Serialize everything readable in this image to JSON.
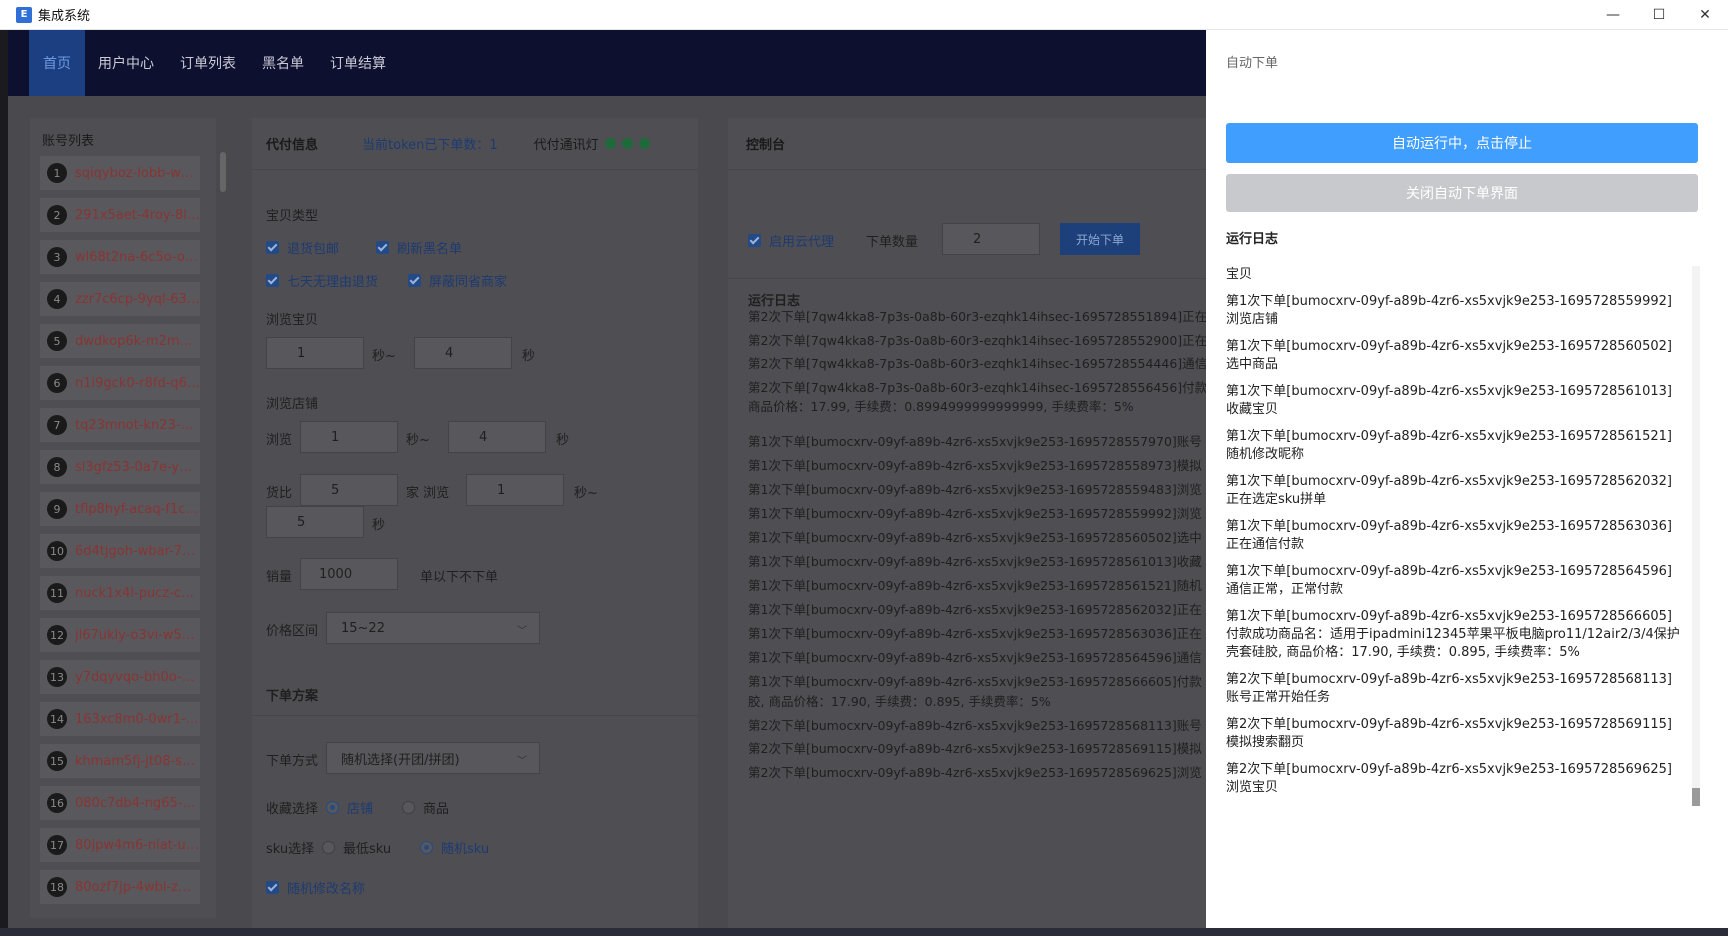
{
  "window": {
    "title": "集成系统",
    "icon": "app-icon",
    "minimize": "—",
    "maximize": "☐",
    "close": "✕"
  },
  "nav": {
    "items": [
      "首页",
      "用户中心",
      "订单列表",
      "黑名单",
      "订单结算"
    ],
    "active": "首页"
  },
  "accounts": {
    "title": "账号列表",
    "items": [
      {
        "n": "1",
        "name": "sqiqyboz-lobb-wm4..."
      },
      {
        "n": "2",
        "name": "291x5aet-4roy-8luk..."
      },
      {
        "n": "3",
        "name": "wl68t2na-6c5o-ofkg..."
      },
      {
        "n": "4",
        "name": "zzr7c6cp-9yql-63wv..."
      },
      {
        "n": "5",
        "name": "dwdkop6k-m2m9-m..."
      },
      {
        "n": "6",
        "name": "n1i9gck0-r8fd-q6ef-..."
      },
      {
        "n": "7",
        "name": "tq23mnot-kn23-85f..."
      },
      {
        "n": "8",
        "name": "sl3gfz53-0a7e-y27r..."
      },
      {
        "n": "9",
        "name": "tflp8hyf-acaq-f1ci-h..."
      },
      {
        "n": "10",
        "name": "6d4tjgoh-wbar-7a..."
      },
      {
        "n": "11",
        "name": "nuck1x4l-pucz-cpo..."
      },
      {
        "n": "12",
        "name": "jl67ukly-o3vi-w5z9..."
      },
      {
        "n": "13",
        "name": "y7dqyvqo-bh0o-zf..."
      },
      {
        "n": "14",
        "name": "163xc8m0-0wr1-q..."
      },
      {
        "n": "15",
        "name": "khmam5fj-jt08-sqa..."
      },
      {
        "n": "16",
        "name": "080c7db4-ng65-ty..."
      },
      {
        "n": "17",
        "name": "80jpw4m6-niat-up..."
      },
      {
        "n": "18",
        "name": "80ozf7jp-4wbl-zm..."
      }
    ]
  },
  "agent": {
    "title": "代付信息",
    "token_count": "当前token已下单数：1",
    "light_label": "代付通讯灯",
    "light_color": "#1e6a3a",
    "item_type_label": "宝贝类型",
    "checks": {
      "return_free": "退货包邮",
      "refresh_blacklist": "刷新黑名单",
      "seven_day": "七天无理由退货",
      "block_same": "屏蔽同省商家"
    },
    "browse_item_label": "浏览宝贝",
    "browse_item_min": "1",
    "browse_item_sep": "秒~",
    "browse_item_max": "4",
    "browse_item_unit": "秒",
    "browse_shop_label": "浏览店铺",
    "browse_label": "浏览",
    "browse_shop_min": "1",
    "browse_shop_sep": "秒~",
    "browse_shop_max": "4",
    "browse_shop_unit": "秒",
    "compare_label": "货比",
    "compare_val": "5",
    "compare_unit": "家 浏览",
    "compare_browse_min": "1",
    "compare_browse_sep": "秒~",
    "compare_browse_max": "5",
    "compare_browse_unit": "秒",
    "sales_label": "销量",
    "sales_val": "1000",
    "sales_unit": "单以下不下单",
    "price_label": "价格区间",
    "price_val": "15~22",
    "plan_label": "下单方案",
    "order_method_label": "下单方式",
    "order_method_val": "随机选择(开团/拼团)",
    "fav_label": "收藏选择",
    "fav_shop": "店铺",
    "fav_item": "商品",
    "sku_label": "sku选择",
    "sku_min": "最低sku",
    "sku_random": "随机sku",
    "rename": "随机修改名称"
  },
  "console": {
    "title": "控制台",
    "cloud_proxy": "启用云代理",
    "qty_label": "下单数量",
    "qty_val": "2",
    "start_label": "开始下单",
    "log_title": "运行日志",
    "lines": [
      "第2次下单[7qw4kka8-7p3s-0a8b-60r3-ezqhk14ihsec-1695728551894]正在",
      "第2次下单[7qw4kka8-7p3s-0a8b-60r3-ezqhk14ihsec-1695728552900]正在",
      "第2次下单[7qw4kka8-7p3s-0a8b-60r3-ezqhk14ihsec-1695728554446]通信",
      "第2次下单[7qw4kka8-7p3s-0a8b-60r3-ezqhk14ihsec-1695728556456]付款",
      "商品价格：17.99, 手续费：0.8994999999999999, 手续费率：5%",
      "第1次下单[bumocxrv-09yf-a89b-4zr6-xs5xvjk9e253-1695728557970]账号",
      "第1次下单[bumocxrv-09yf-a89b-4zr6-xs5xvjk9e253-1695728558973]模拟",
      "第1次下单[bumocxrv-09yf-a89b-4zr6-xs5xvjk9e253-1695728559483]浏览",
      "第1次下单[bumocxrv-09yf-a89b-4zr6-xs5xvjk9e253-1695728559992]浏览",
      "第1次下单[bumocxrv-09yf-a89b-4zr6-xs5xvjk9e253-1695728560502]选中",
      "第1次下单[bumocxrv-09yf-a89b-4zr6-xs5xvjk9e253-1695728561013]收藏",
      "第1次下单[bumocxrv-09yf-a89b-4zr6-xs5xvjk9e253-1695728561521]随机",
      "第1次下单[bumocxrv-09yf-a89b-4zr6-xs5xvjk9e253-1695728562032]正在",
      "第1次下单[bumocxrv-09yf-a89b-4zr6-xs5xvjk9e253-1695728563036]正在",
      "第1次下单[bumocxrv-09yf-a89b-4zr6-xs5xvjk9e253-1695728564596]通信",
      "第1次下单[bumocxrv-09yf-a89b-4zr6-xs5xvjk9e253-1695728566605]付款",
      "胶, 商品价格：17.90, 手续费：0.895, 手续费率：5%",
      "第2次下单[bumocxrv-09yf-a89b-4zr6-xs5xvjk9e253-1695728568113]账号",
      "第2次下单[bumocxrv-09yf-a89b-4zr6-xs5xvjk9e253-1695728569115]模拟",
      "第2次下单[bumocxrv-09yf-a89b-4zr6-xs5xvjk9e253-1695728569625]浏览"
    ]
  },
  "drawer": {
    "title": "自动下单",
    "stop_btn": "自动运行中，点击停止",
    "close_btn": "关闭自动下单界面",
    "log_title": "运行日志",
    "accent": "#409eff",
    "logs": [
      "宝贝",
      "第1次下单[bumocxrv-09yf-a89b-4zr6-xs5xvjk9e253-1695728559992]浏览店铺",
      "第1次下单[bumocxrv-09yf-a89b-4zr6-xs5xvjk9e253-1695728560502]选中商品",
      "第1次下单[bumocxrv-09yf-a89b-4zr6-xs5xvjk9e253-1695728561013]收藏宝贝",
      "第1次下单[bumocxrv-09yf-a89b-4zr6-xs5xvjk9e253-1695728561521]随机修改昵称",
      "第1次下单[bumocxrv-09yf-a89b-4zr6-xs5xvjk9e253-1695728562032]正在选定sku拼单",
      "第1次下单[bumocxrv-09yf-a89b-4zr6-xs5xvjk9e253-1695728563036]正在通信付款",
      "第1次下单[bumocxrv-09yf-a89b-4zr6-xs5xvjk9e253-1695728564596]通信正常，正常付款",
      "第1次下单[bumocxrv-09yf-a89b-4zr6-xs5xvjk9e253-1695728566605]付款成功商品名：适用于ipadmini12345苹果平板电脑pro11/12air2/3/4保护壳套硅胶, 商品价格：17.90, 手续费：0.895, 手续费率：5%",
      "第2次下单[bumocxrv-09yf-a89b-4zr6-xs5xvjk9e253-1695728568113]账号正常开始任务",
      "第2次下单[bumocxrv-09yf-a89b-4zr6-xs5xvjk9e253-1695728569115]模拟搜索翻页",
      "第2次下单[bumocxrv-09yf-a89b-4zr6-xs5xvjk9e253-1695728569625]浏览宝贝"
    ]
  }
}
